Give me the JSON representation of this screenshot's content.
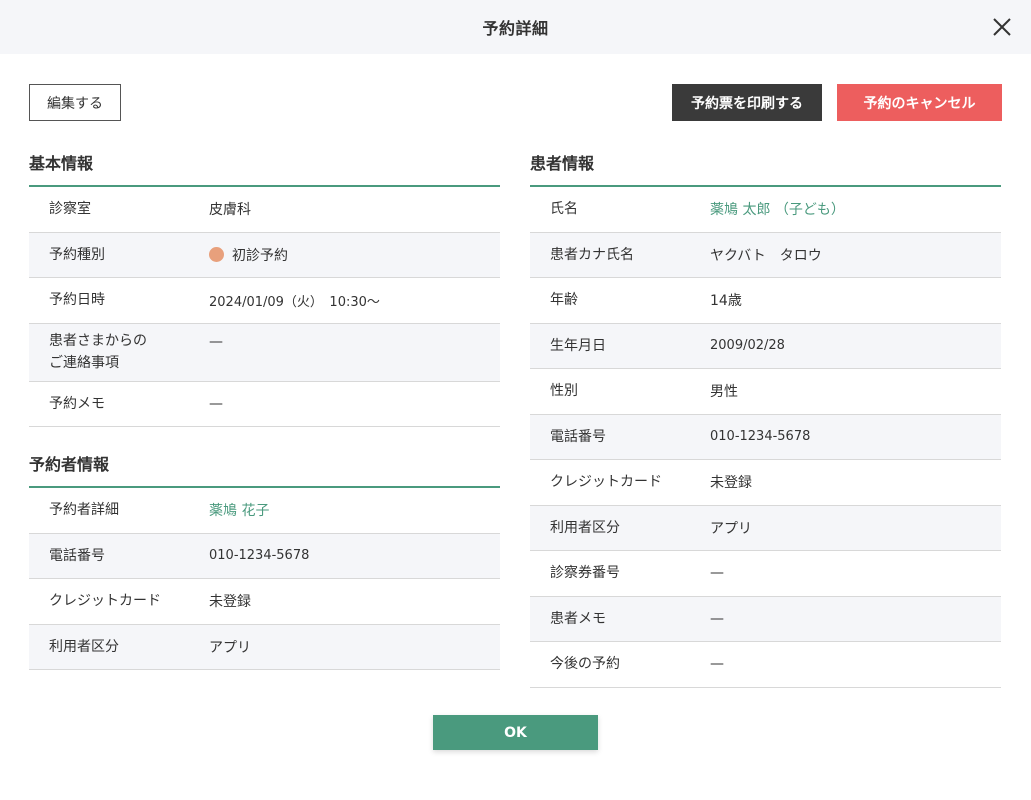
{
  "dialog": {
    "title": "予約詳細"
  },
  "toolbar": {
    "edit_label": "編集する",
    "print_label": "予約票を印刷する",
    "cancel_label": "予約のキャンセル"
  },
  "basic_info": {
    "title": "基本情報",
    "rows": [
      {
        "label": "診察室",
        "value": "皮膚科"
      },
      {
        "label": "予約種別",
        "value": "初診予約",
        "dot_color": "#e8a07c"
      },
      {
        "label": "予約日時",
        "value": "2024/01/09（火）　10:30〜"
      },
      {
        "label_line1": "患者さまからの",
        "label_line2": "ご連絡事項",
        "value": "—"
      },
      {
        "label": "予約メモ",
        "value": "—"
      }
    ]
  },
  "booker_info": {
    "title": "予約者情報",
    "rows": [
      {
        "label": "予約者詳細",
        "value": "薬鳩 花子"
      },
      {
        "label": "電話番号",
        "value": "010-1234-5678"
      },
      {
        "label": "クレジットカード",
        "value": "未登録"
      },
      {
        "label": "利用者区分",
        "value": "アプリ"
      }
    ]
  },
  "patient_info": {
    "title": "患者情報",
    "rows": [
      {
        "label": "氏名",
        "value": "薬鳩 太郎 （子ども）"
      },
      {
        "label": "患者カナ氏名",
        "value": "ヤクバト　タロウ"
      },
      {
        "label": "年齢",
        "value": "14歳"
      },
      {
        "label": "生年月日",
        "value": "2009/02/28"
      },
      {
        "label": "性別",
        "value": "男性"
      },
      {
        "label": "電話番号",
        "value": "010-1234-5678"
      },
      {
        "label": "クレジットカード",
        "value": "未登録"
      },
      {
        "label": "利用者区分",
        "value": "アプリ"
      },
      {
        "label": "診察券番号",
        "value": "—"
      },
      {
        "label": "患者メモ",
        "value": "—"
      },
      {
        "label": "今後の予約",
        "value": "—"
      }
    ]
  },
  "footer": {
    "ok_label": "OK"
  },
  "colors": {
    "accent": "#4a9a7e",
    "danger": "#ed5e5e",
    "dark": "#3a3a3a",
    "row_alt": "#f5f6f9"
  },
  "icons": {
    "close": "close-icon",
    "type_dot": "status-dot-icon"
  }
}
